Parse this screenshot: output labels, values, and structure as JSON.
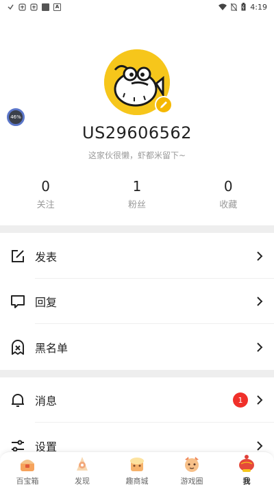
{
  "status_bar": {
    "time": "4:19",
    "icons": [
      "app-icon-1",
      "app-icon-2",
      "app-icon-3",
      "app-icon-4",
      "wifi-icon",
      "no-sim-icon",
      "battery-icon"
    ]
  },
  "profile": {
    "progress": "46%",
    "username": "US29606562",
    "bio": "这家伙很懒，虾都米留下~"
  },
  "stats": [
    {
      "value": "0",
      "label": "关注"
    },
    {
      "value": "1",
      "label": "粉丝"
    },
    {
      "value": "0",
      "label": "收藏"
    }
  ],
  "menu": {
    "post": {
      "label": "发表",
      "icon": "edit-icon"
    },
    "reply": {
      "label": "回复",
      "icon": "comment-icon"
    },
    "blacklist": {
      "label": "黑名单",
      "icon": "blacklist-icon"
    },
    "messages": {
      "label": "消息",
      "icon": "bell-icon",
      "badge": "1"
    },
    "settings": {
      "label": "设置",
      "icon": "settings-sliders-icon"
    }
  },
  "bottom_nav": [
    {
      "label": "百宝箱",
      "icon": "treasure-box-icon"
    },
    {
      "label": "发现",
      "icon": "discover-icon"
    },
    {
      "label": "趣商城",
      "icon": "mall-icon"
    },
    {
      "label": "游戏圈",
      "icon": "game-circle-icon"
    },
    {
      "label": "我",
      "icon": "me-icon",
      "active": true
    }
  ],
  "colors": {
    "accent_yellow": "#f6c61b",
    "badge_red": "#f0302a",
    "divider": "#eeeeee"
  }
}
